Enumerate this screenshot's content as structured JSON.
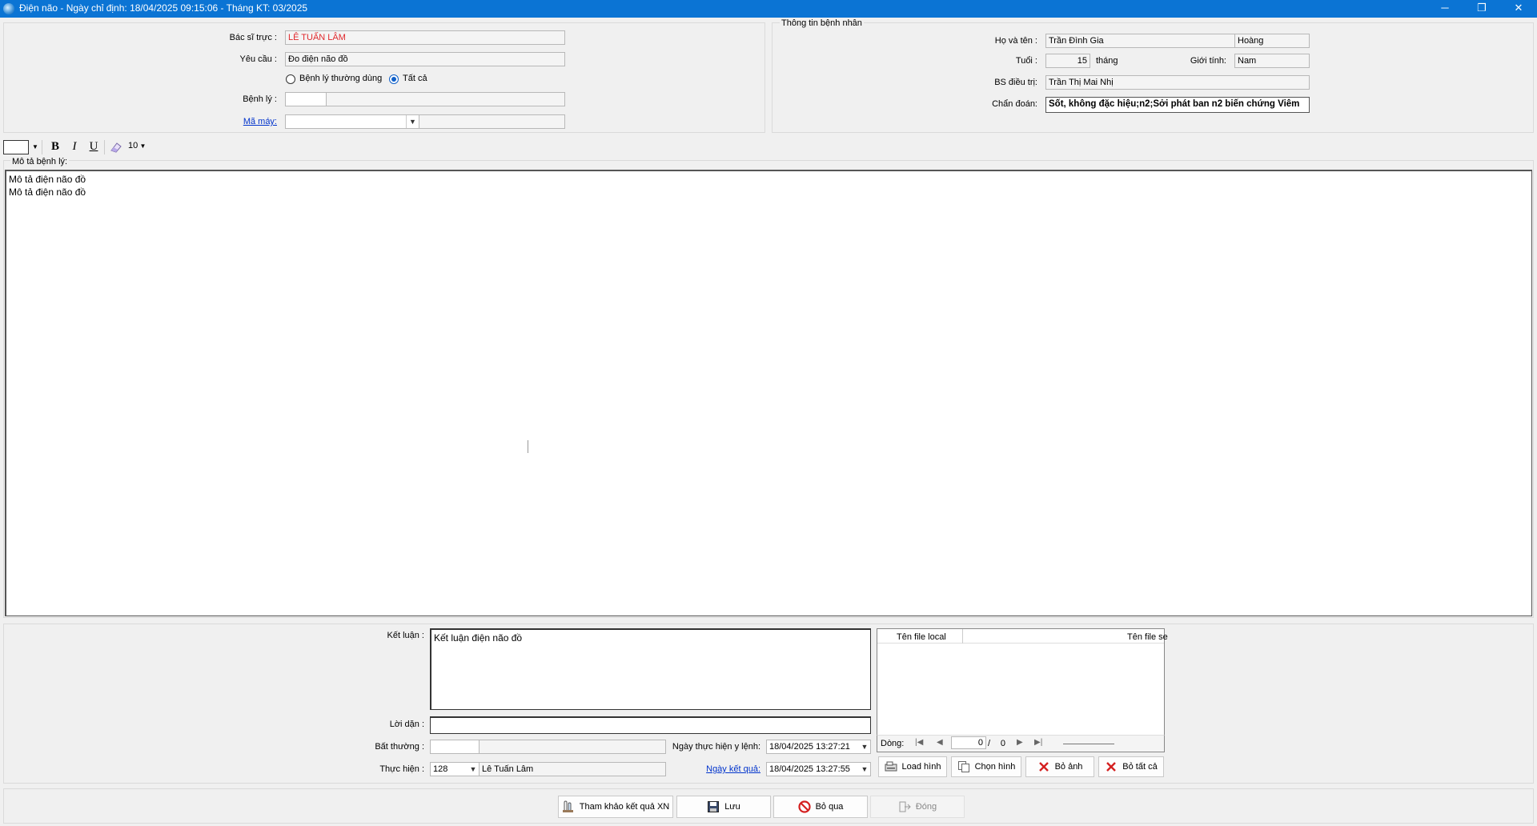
{
  "window": {
    "title": "Điện não - Ngày chỉ định: 18/04/2025 09:15:06 - Tháng KT: 03/2025",
    "minimize": "─",
    "restore": "❐",
    "close": "✕"
  },
  "request": {
    "doctor_label": "Bác sĩ trực :",
    "doctor_value": "LÊ TUẤN LÂM",
    "request_label": "Yêu cầu :",
    "request_value": "Đo điện não đồ",
    "radio_common": "Bệnh lý thường dùng",
    "radio_all": "Tất cả",
    "radio_selected": "all",
    "disease_label": "Bệnh lý :",
    "disease_code": "",
    "disease_name": "",
    "machine_label": "Mã máy:",
    "machine_value": "",
    "machine_name": ""
  },
  "patient": {
    "group_title": "Thông tin bệnh nhân",
    "name_label": "Họ và tên :",
    "last_middle": "Trần Đình Gia",
    "first_name": "Hoàng",
    "age_label": "Tuổi :",
    "age": "15",
    "age_unit": "tháng",
    "sex_label": "Giới tính:",
    "sex": "Nam",
    "attending_label": "BS điều trị:",
    "attending": "Trần Thị Mai Nhị",
    "diagnosis_label": "Chẩn đoán:",
    "diagnosis": "Sốt, không đặc hiệu;n2;Sởi phát ban n2 biến chứng Viêm"
  },
  "toolbar": {
    "bold": "B",
    "italic": "I",
    "underline": "U",
    "font_size": "10"
  },
  "description": {
    "label": "Mô tả bệnh lý:",
    "text": "Mô tả điện não đồ\nMô tả điện não đồ"
  },
  "result": {
    "conclusion_label": "Kết luận :",
    "conclusion": "Kết luận điện não đồ",
    "advice_label": "Lời dặn :",
    "advice": "",
    "abnormal_label": "Bất thường :",
    "abnormal_code": "",
    "abnormal_name": "",
    "performer_label": "Thực hiện :",
    "performer_code": "128",
    "performer_name": "Lê Tuấn Lâm",
    "order_date_label": "Ngày thực hiện y lệnh:",
    "order_date": "18/04/2025 13:27:21",
    "result_date_label": "Ngày kết quả:",
    "result_date": "18/04/2025 13:27:55"
  },
  "files": {
    "col_local": "Tên file local",
    "col_server": "Tên file se",
    "row_label": "Dòng:",
    "current": "0",
    "separator": "/",
    "total": "0",
    "load_image": "Load hình",
    "choose_image": "Chọn hình",
    "remove_image": "Bỏ ảnh",
    "remove_all": "Bỏ tất cả"
  },
  "actions": {
    "reference": "Tham khảo kết quả XN",
    "save": "Lưu",
    "skip": "Bỏ qua",
    "close": "Đóng"
  }
}
